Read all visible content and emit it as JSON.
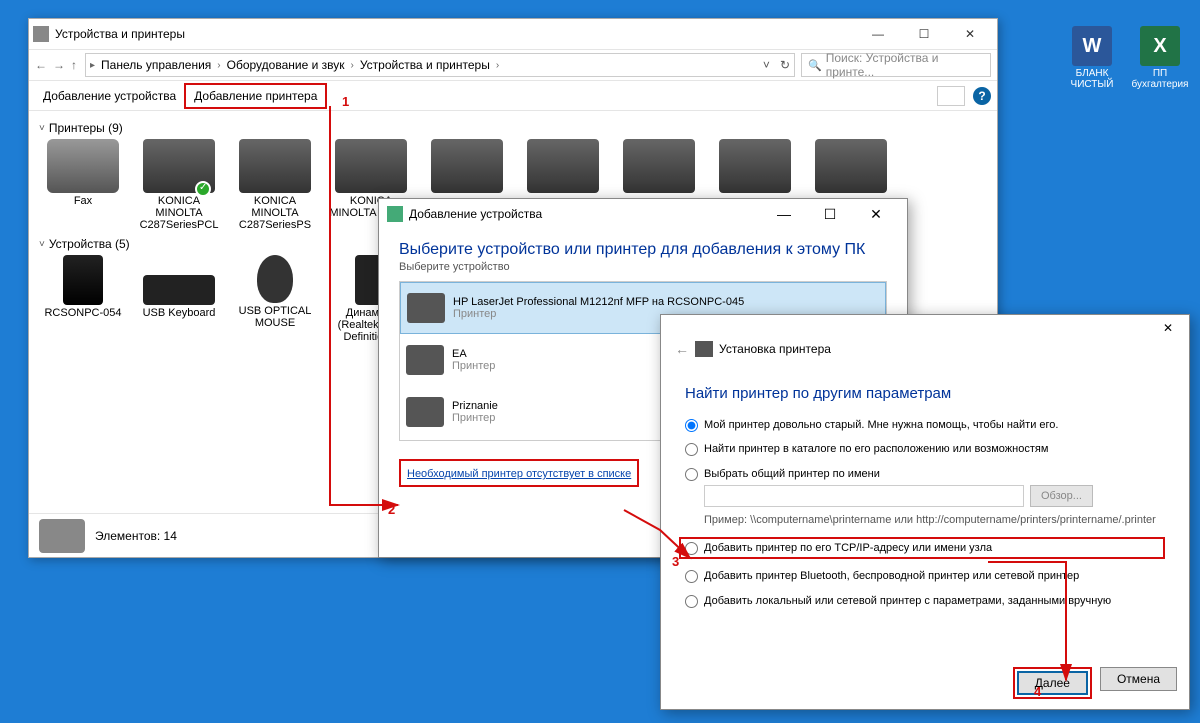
{
  "desktop": {
    "icons": [
      {
        "label": "БЛАНК ЧИСТЫЙ",
        "type": "word"
      },
      {
        "label": "ПП бухгалтерия",
        "type": "excel"
      }
    ]
  },
  "explorer": {
    "title": "Устройства и принтеры",
    "breadcrumbs": [
      "Панель управления",
      "Оборудование и звук",
      "Устройства и принтеры"
    ],
    "search_placeholder": "Поиск: Устройства и принте...",
    "toolbar": {
      "add_device": "Добавление устройства",
      "add_printer": "Добавление принтера"
    },
    "groups": {
      "printers": {
        "header": "Принтеры (9)",
        "items": [
          {
            "label": "Fax",
            "kind": "fax"
          },
          {
            "label": "KONICA MINOLTA C287SeriesPCL",
            "kind": "printer",
            "check": true
          },
          {
            "label": "KONICA MINOLTA C287SeriesPS",
            "kind": "printer"
          },
          {
            "label": "KONICA MINOLTA C287S",
            "kind": "printer"
          },
          {
            "label": "",
            "kind": "printer"
          },
          {
            "label": "",
            "kind": "printer"
          },
          {
            "label": "",
            "kind": "printer"
          },
          {
            "label": "",
            "kind": "printer"
          },
          {
            "label": "",
            "kind": "printer"
          }
        ]
      },
      "devices": {
        "header": "Устройства (5)",
        "items": [
          {
            "label": "RCSONPC-054",
            "kind": "pc"
          },
          {
            "label": "USB Keyboard",
            "kind": "kb"
          },
          {
            "label": "USB OPTICAL MOUSE",
            "kind": "mouse"
          },
          {
            "label": "Динамики (Realtek High Definition...",
            "kind": "spk"
          },
          {
            "label": "",
            "kind": "spk"
          }
        ]
      }
    },
    "status": "Элементов: 14"
  },
  "adddev": {
    "title": "Добавление устройства",
    "heading": "Выберите устройство или принтер для добавления к этому ПК",
    "sub": "Выберите устройство",
    "list": [
      {
        "name": "HP LaserJet Professional M1212nf MFP на RCSONPC-045",
        "type": "Принтер",
        "sel": true
      },
      {
        "name": "EA",
        "type": "Принтер"
      },
      {
        "name": "Priznanie",
        "type": "Принтер"
      }
    ],
    "not_in_list": "Необходимый принтер отсутствует в списке"
  },
  "wiz": {
    "title": "Установка принтера",
    "heading": "Найти принтер по другим параметрам",
    "options": {
      "o1": "Мой принтер довольно старый. Мне нужна помощь, чтобы найти его.",
      "o2": "Найти принтер в каталоге по его расположению или возможностям",
      "o3": "Выбрать общий принтер по имени",
      "o3_example": "Пример: \\\\computername\\printername или http://computername/printers/printername/.printer",
      "o3_browse": "Обзор...",
      "o4": "Добавить принтер по его TCP/IP-адресу или имени узла",
      "o5": "Добавить принтер Bluetooth, беспроводной принтер или сетевой принтер",
      "o6": "Добавить локальный или сетевой принтер с параметрами, заданными вручную"
    },
    "buttons": {
      "next": "Далее",
      "cancel": "Отмена"
    }
  },
  "anno": {
    "n1": "1",
    "n2": "2",
    "n3": "3",
    "n4": "4"
  }
}
